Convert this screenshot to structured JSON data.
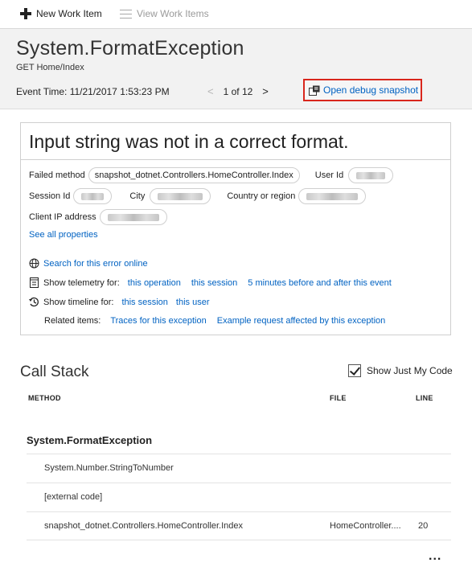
{
  "toolbar": {
    "new_work_item": "New Work Item",
    "view_work_items": "View Work Items"
  },
  "header": {
    "title": "System.FormatException",
    "subtitle": "GET Home/Index",
    "event_time": "Event Time: 11/21/2017 1:53:23 PM",
    "pager": {
      "prev": "<",
      "text": "1 of 12",
      "next": ">"
    },
    "debug_snapshot": "Open debug snapshot"
  },
  "card": {
    "message": "Input string was not in a correct format.",
    "failed_method_label": "Failed method",
    "failed_method_value": "snapshot_dotnet.Controllers.HomeController.Index",
    "user_id_label": "User Id",
    "session_id_label": "Session Id",
    "city_label": "City",
    "country_label": "Country or region",
    "client_ip_label": "Client IP address",
    "see_all": "See all properties",
    "search_online": "Search for this error online",
    "telemetry_label": "Show telemetry for:",
    "telemetry_links": [
      "this operation",
      "this session",
      "5 minutes before and after this event"
    ],
    "timeline_label": "Show timeline for:",
    "timeline_links": [
      "this session",
      "this user"
    ],
    "related_label": "Related items:",
    "related_links": [
      "Traces for this exception",
      "Example request affected by this exception"
    ]
  },
  "callstack": {
    "title": "Call Stack",
    "show_just_my_code": "Show Just My Code",
    "show_just_my_code_checked": true,
    "columns": {
      "method": "METHOD",
      "file": "FILE",
      "line": "LINE"
    },
    "exception": "System.FormatException",
    "rows": [
      {
        "method": "System.Number.StringToNumber",
        "file": "",
        "line": ""
      },
      {
        "method": "[external code]",
        "file": "",
        "line": ""
      },
      {
        "method": "snapshot_dotnet.Controllers.HomeController.Index",
        "file": "HomeController....",
        "line": "20"
      }
    ],
    "more": "..."
  },
  "colors": {
    "link": "#0062c2",
    "highlight_border": "#d9261c",
    "header_bg": "#f2f2f2"
  }
}
